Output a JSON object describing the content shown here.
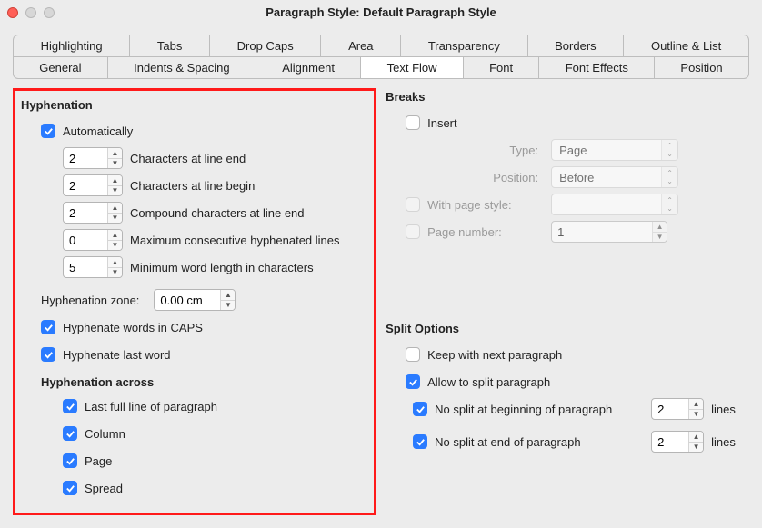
{
  "window": {
    "title": "Paragraph Style: Default Paragraph Style"
  },
  "tabs": {
    "row1": [
      "Highlighting",
      "Tabs",
      "Drop Caps",
      "Area",
      "Transparency",
      "Borders",
      "Outline & List"
    ],
    "row2": [
      "General",
      "Indents & Spacing",
      "Alignment",
      "Text Flow",
      "Font",
      "Font Effects",
      "Position"
    ],
    "active": "Text Flow"
  },
  "hyphenation": {
    "title": "Hyphenation",
    "automatically": {
      "label": "Automatically",
      "checked": true
    },
    "charsEnd": {
      "value": "2",
      "label": "Characters at line end"
    },
    "charsBegin": {
      "value": "2",
      "label": "Characters at line begin"
    },
    "compound": {
      "value": "2",
      "label": "Compound characters at line end"
    },
    "maxConsec": {
      "value": "0",
      "label": "Maximum consecutive hyphenated lines"
    },
    "minWord": {
      "value": "5",
      "label": "Minimum word length in characters"
    },
    "zone": {
      "label": "Hyphenation zone:",
      "value": "0.00 cm"
    },
    "caps": {
      "label": "Hyphenate words in CAPS",
      "checked": true
    },
    "lastWord": {
      "label": "Hyphenate last word",
      "checked": true
    },
    "across": {
      "title": "Hyphenation across",
      "lastFullLine": {
        "label": "Last full line of paragraph",
        "checked": true
      },
      "column": {
        "label": "Column",
        "checked": true
      },
      "page": {
        "label": "Page",
        "checked": true
      },
      "spread": {
        "label": "Spread",
        "checked": true
      }
    }
  },
  "breaks": {
    "title": "Breaks",
    "insert": {
      "label": "Insert",
      "checked": false
    },
    "type": {
      "label": "Type:",
      "value": "Page"
    },
    "position": {
      "label": "Position:",
      "value": "Before"
    },
    "withPageStyle": {
      "label": "With page style:",
      "checked": false,
      "value": ""
    },
    "pageNumber": {
      "label": "Page number:",
      "checked": false,
      "value": "1"
    }
  },
  "split": {
    "title": "Split Options",
    "keepNext": {
      "label": "Keep with next paragraph",
      "checked": false
    },
    "allowSplit": {
      "label": "Allow to split paragraph",
      "checked": true
    },
    "noSplitBegin": {
      "label": "No split at beginning of paragraph",
      "checked": true,
      "value": "2",
      "unit": "lines"
    },
    "noSplitEnd": {
      "label": "No split at end of paragraph",
      "checked": true,
      "value": "2",
      "unit": "lines"
    }
  }
}
